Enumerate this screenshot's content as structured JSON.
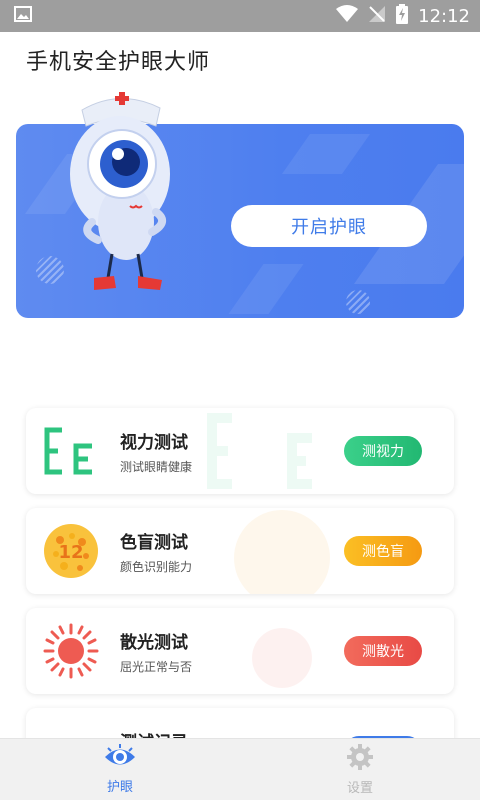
{
  "status_bar": {
    "time": "12:12",
    "icons": [
      "image-icon",
      "wifi-icon",
      "signal-off-icon",
      "battery-charging-icon"
    ]
  },
  "header": {
    "title": "手机安全护眼大师"
  },
  "banner": {
    "button_label": "开启护眼",
    "accent": "#4e7fef"
  },
  "cards": [
    {
      "title": "视力测试",
      "subtitle": "测试眼睛健康",
      "button_label": "测视力",
      "icon": "eye-chart-icon",
      "color": "#2ec47f"
    },
    {
      "title": "色盲测试",
      "subtitle": "颜色识别能力",
      "button_label": "测色盲",
      "icon": "color-blind-plate-icon",
      "color": "#f7a21b"
    },
    {
      "title": "散光测试",
      "subtitle": "屈光正常与否",
      "button_label": "测散光",
      "icon": "astigmatism-sun-icon",
      "color": "#ee5b52"
    },
    {
      "title": "测试记录",
      "icon": "record-icon",
      "color": "#3f7be8"
    }
  ],
  "bottom_nav": {
    "items": [
      {
        "label": "护眼",
        "icon": "eye-icon",
        "active": true,
        "color": "#3f7be8"
      },
      {
        "label": "设置",
        "icon": "gear-icon",
        "active": false,
        "color": "#b8b8b8"
      }
    ]
  }
}
